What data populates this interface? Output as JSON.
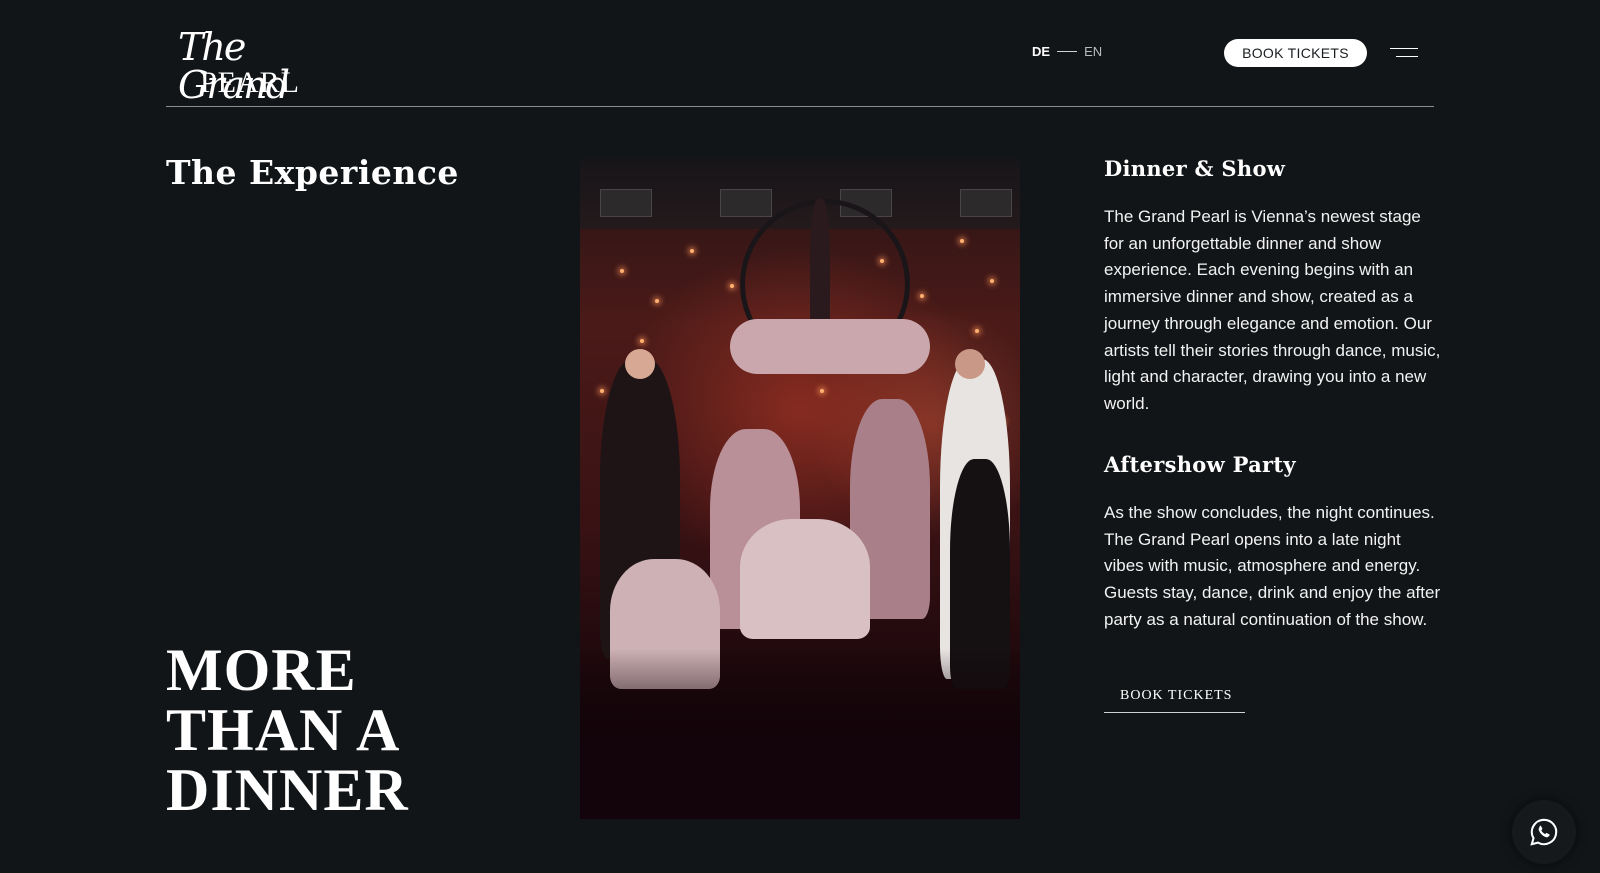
{
  "header": {
    "logo_script": "The Grand",
    "logo_caps": "PEARL",
    "lang_active": "DE",
    "lang_other": "EN",
    "book_button": "BOOK TICKETS",
    "menu_icon": "hamburger-icon"
  },
  "main": {
    "experience_title": "The Experience",
    "big_title_lines": [
      "MORE",
      "THAN A",
      "DINNER"
    ],
    "photo_alt": "performers-photo"
  },
  "sections": [
    {
      "heading": "Dinner & Show",
      "body": "The Grand Pearl is Vienna’s newest stage for an unforgettable dinner and show experience. Each evening begins with an immersive dinner and show, created as a journey through elegance and emotion. Our artists tell their stories through dance, music, light and character, drawing you into a new world."
    },
    {
      "heading": "Aftershow Party",
      "body": "As the show concludes, the night continues. The Grand Pearl opens into a late night vibes with music, atmosphere and energy. Guests stay, dance, drink and enjoy the after party as a natural continuation of the show."
    }
  ],
  "cta": {
    "book_link": "BOOK TICKETS"
  },
  "floating": {
    "whatsapp_icon": "whatsapp-icon"
  },
  "colors": {
    "background": "#111517",
    "text": "#ffffff",
    "pill_bg": "#ffffff"
  }
}
